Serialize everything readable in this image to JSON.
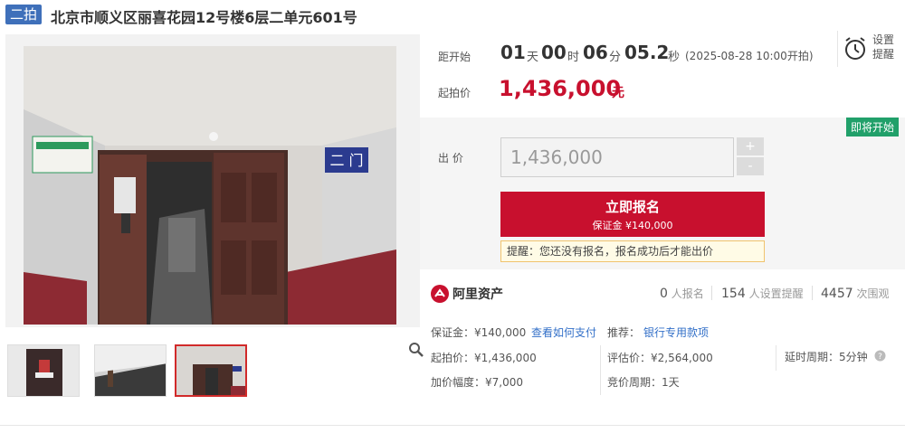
{
  "header": {
    "badge": "二拍",
    "title": "北京市顺义区丽喜花园12号楼6层二单元601号"
  },
  "countdown": {
    "label": "距开始",
    "days": "01",
    "days_unit": "天",
    "hours": "00",
    "hours_unit": "时",
    "minutes": "06",
    "minutes_unit": "分",
    "seconds": "05.2",
    "seconds_unit": "秒",
    "start_note": "(2025-08-28 10:00开拍)"
  },
  "starting_price": {
    "label": "起拍价",
    "value": "1,436,000",
    "unit": "元"
  },
  "reminder": {
    "line1": "设置",
    "line2": "提醒"
  },
  "bid": {
    "status_badge": "即将开始",
    "label": "出 价",
    "input_value": "1,436,000",
    "plus": "+",
    "minus": "-",
    "signup_label": "立即报名",
    "deposit_label": "保证金 ¥140,000",
    "tip": "提醒：您还没有报名，报名成功后才能出价"
  },
  "stats": {
    "brand": "阿里资产",
    "signups_count": "0",
    "signups_label": "人报名",
    "reminders_count": "154",
    "reminders_label": "人设置提醒",
    "views_count": "4457",
    "views_label": "次围观"
  },
  "details": {
    "deposit": "保证金：¥140,000",
    "how_to_pay": "查看如何支付",
    "recommend_label": "推荐：",
    "recommend_link": "银行专用款项",
    "start_price": "起拍价：¥1,436,000",
    "appraisal": "评估价：¥2,564,000",
    "delay": "延时周期：5分钟",
    "increment": "加价幅度：¥7,000",
    "cycle": "竞价周期：1天"
  },
  "colors": {
    "accent_red": "#c8102e",
    "badge_blue": "#3f70ba",
    "soon_green": "#21a06a",
    "link_blue": "#3370c8"
  }
}
